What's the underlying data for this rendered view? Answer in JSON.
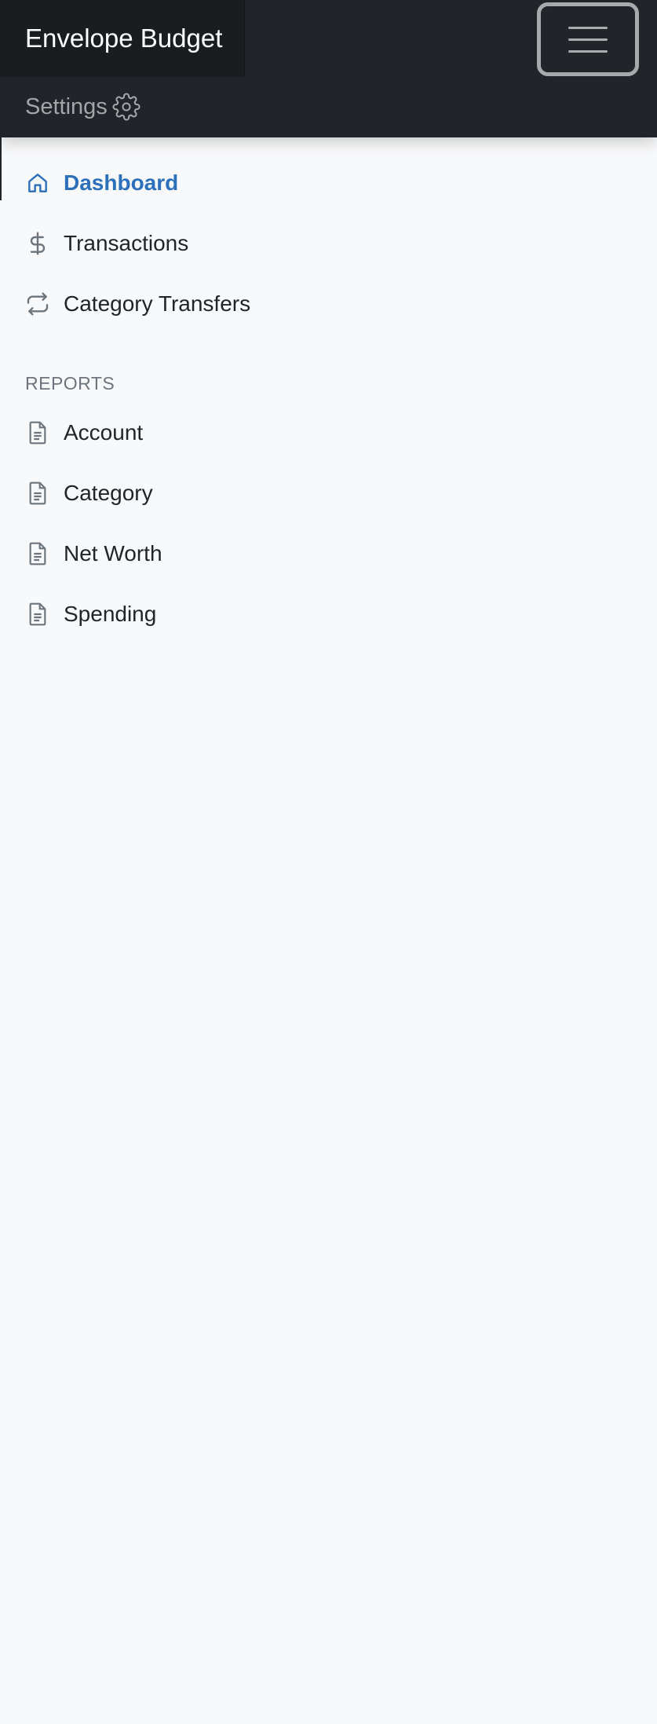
{
  "header": {
    "brand": "Envelope Budget",
    "settings_label": "Settings",
    "toggler_icon": "hamburger-menu-icon"
  },
  "sidebar": {
    "main_items": [
      {
        "label": "Dashboard",
        "icon": "house-icon",
        "active": true
      },
      {
        "label": "Transactions",
        "icon": "dollar-icon",
        "active": false
      },
      {
        "label": "Category Transfers",
        "icon": "repeat-arrows-icon",
        "active": false
      }
    ],
    "reports_heading": "REPORTS",
    "report_items": [
      {
        "label": "Account",
        "icon": "document-icon"
      },
      {
        "label": "Category",
        "icon": "document-icon"
      },
      {
        "label": "Net Worth",
        "icon": "document-icon"
      },
      {
        "label": "Spending",
        "icon": "document-icon"
      }
    ]
  },
  "colors": {
    "navbar_bg": "#212529",
    "active_link": "#2c6fbb",
    "page_bg": "#f8f9fa"
  }
}
